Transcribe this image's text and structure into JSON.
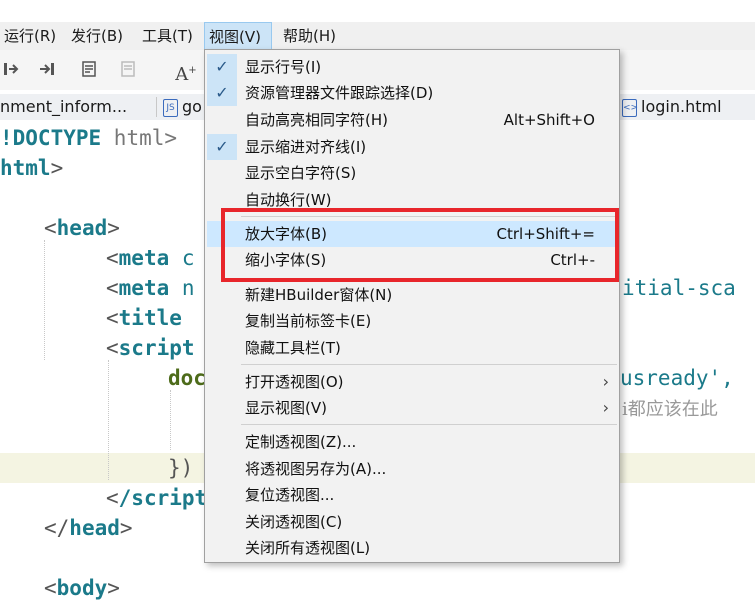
{
  "menubar": {
    "items": [
      {
        "label": "运行(R)"
      },
      {
        "label": "发行(B)"
      },
      {
        "label": "工具(T)"
      },
      {
        "label": "视图(V)"
      },
      {
        "label": "帮助(H)"
      }
    ]
  },
  "toolbar": {
    "icons": [
      "step-into-icon",
      "step-over-icon",
      "document-icon",
      "document-disabled-icon",
      "font-size-icon"
    ],
    "font_glyph": "A"
  },
  "tabs": [
    {
      "label": "nment_inform...",
      "icon": "file-icon"
    },
    {
      "label": "go",
      "icon": "js-file-icon",
      "badge": "JS"
    },
    {
      "label": "login.html",
      "icon": "html-file-icon",
      "badge": "<>"
    }
  ],
  "editor": {
    "lines": {
      "l1": "!DOCTYPE",
      "l1b": " html>",
      "l2": "html",
      "l3": "head",
      "l4": "meta",
      "l4b": " c",
      "l5": "meta",
      "l5b": " n",
      "l5c": "itial-sca",
      "l6": "title",
      "l7": "script",
      "l8": "doc",
      "l8b": "usready',",
      "l8c": "i都应该在此",
      "l9": "})",
      "l10": "/script",
      "l11": "head",
      "l12": "body"
    }
  },
  "view_menu": {
    "items": [
      {
        "label": "显示行号(I)",
        "checked": true,
        "shortcut": ""
      },
      {
        "label": "资源管理器文件跟踪选择(D)",
        "checked": true,
        "shortcut": ""
      },
      {
        "label": "自动高亮相同字符(H)",
        "checked": false,
        "shortcut": "Alt+Shift+O"
      },
      {
        "label": "显示缩进对齐线(I)",
        "checked": true,
        "shortcut": ""
      },
      {
        "label": "显示空白字符(S)",
        "checked": false,
        "shortcut": ""
      },
      {
        "label": "自动换行(W)",
        "checked": false,
        "shortcut": ""
      },
      {
        "label": "放大字体(B)",
        "checked": false,
        "shortcut": "Ctrl+Shift+="
      },
      {
        "label": "缩小字体(S)",
        "checked": false,
        "shortcut": "Ctrl+-"
      },
      {
        "label": "新建HBuilder窗体(N)",
        "checked": false,
        "shortcut": ""
      },
      {
        "label": "复制当前标签卡(E)",
        "checked": false,
        "shortcut": ""
      },
      {
        "label": "隐藏工具栏(T)",
        "checked": false,
        "shortcut": ""
      },
      {
        "label": "打开透视图(O)",
        "checked": false,
        "shortcut": "",
        "submenu": true
      },
      {
        "label": "显示视图(V)",
        "checked": false,
        "shortcut": "",
        "submenu": true
      },
      {
        "label": "定制透视图(Z)...",
        "checked": false,
        "shortcut": ""
      },
      {
        "label": "将透视图另存为(A)...",
        "checked": false,
        "shortcut": ""
      },
      {
        "label": "复位透视图...",
        "checked": false,
        "shortcut": ""
      },
      {
        "label": "关闭透视图(C)",
        "checked": false,
        "shortcut": ""
      },
      {
        "label": "关闭所有透视图(L)",
        "checked": false,
        "shortcut": ""
      }
    ],
    "check_glyph": "✓",
    "submenu_glyph": "›"
  },
  "colors": {
    "highlight_box": "#e8262b",
    "menu_hover": "#cde8ff",
    "check_bg": "#cce4f7",
    "code_keyword": "#1b7a8a"
  }
}
